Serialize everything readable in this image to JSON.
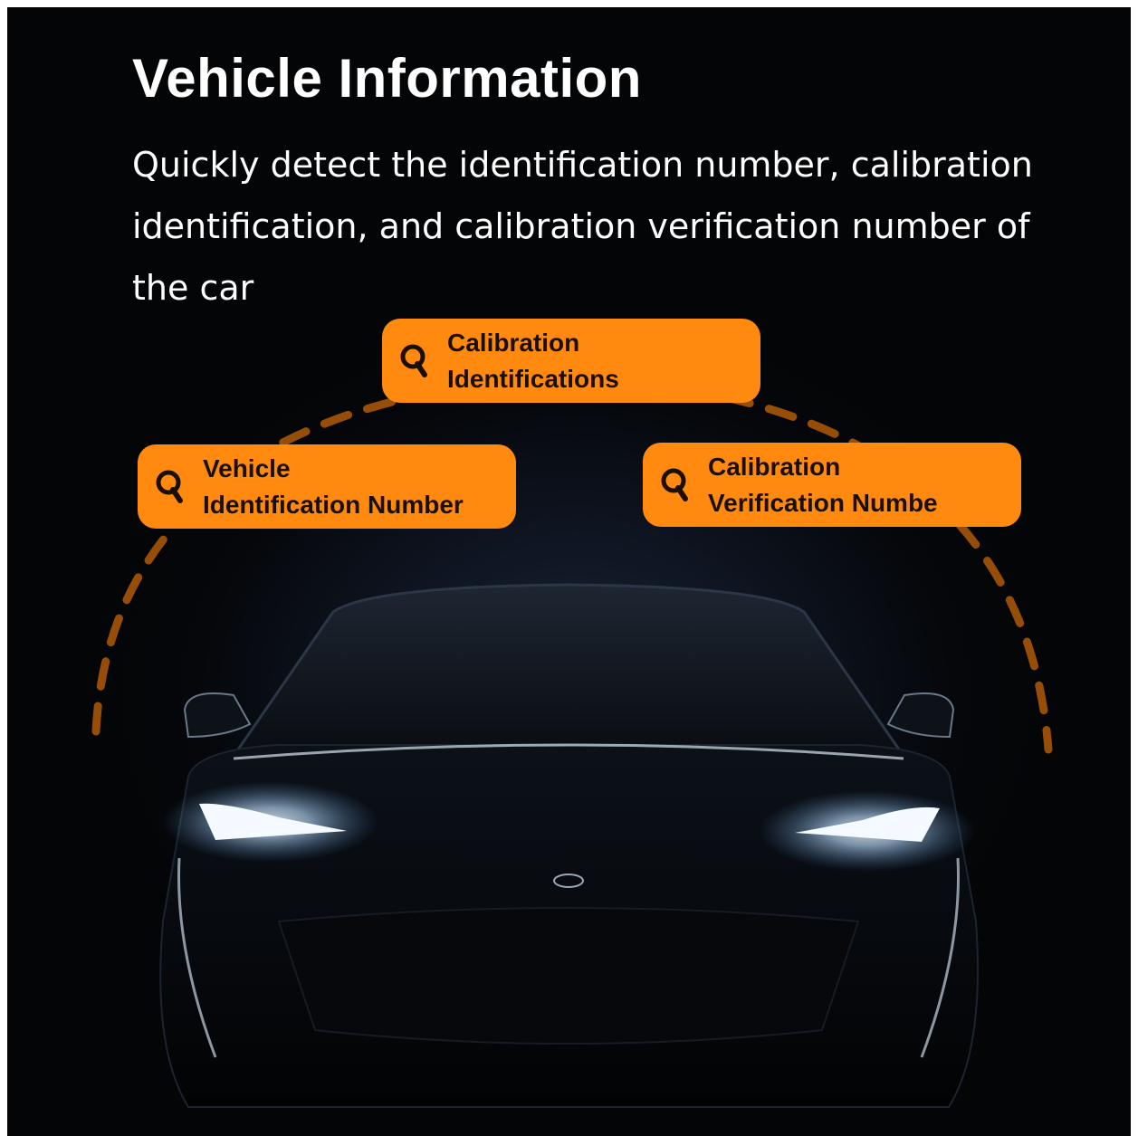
{
  "header": {
    "title": "Vehicle Information",
    "subtitle": "Quickly detect the identification number, calibration identification, and calibration verification number of the car"
  },
  "features": [
    {
      "label": "Calibration\nIdentifications",
      "icon": "magnifier-icon"
    },
    {
      "label": "Vehicle\nIdentification Number",
      "icon": "magnifier-icon"
    },
    {
      "label": "Calibration\nVerification Numbe",
      "icon": "magnifier-icon"
    }
  ],
  "colors": {
    "accent": "#ff8a0f",
    "background": "#05070b",
    "text": "#ffffff",
    "headlight": "#e8f4ff"
  }
}
